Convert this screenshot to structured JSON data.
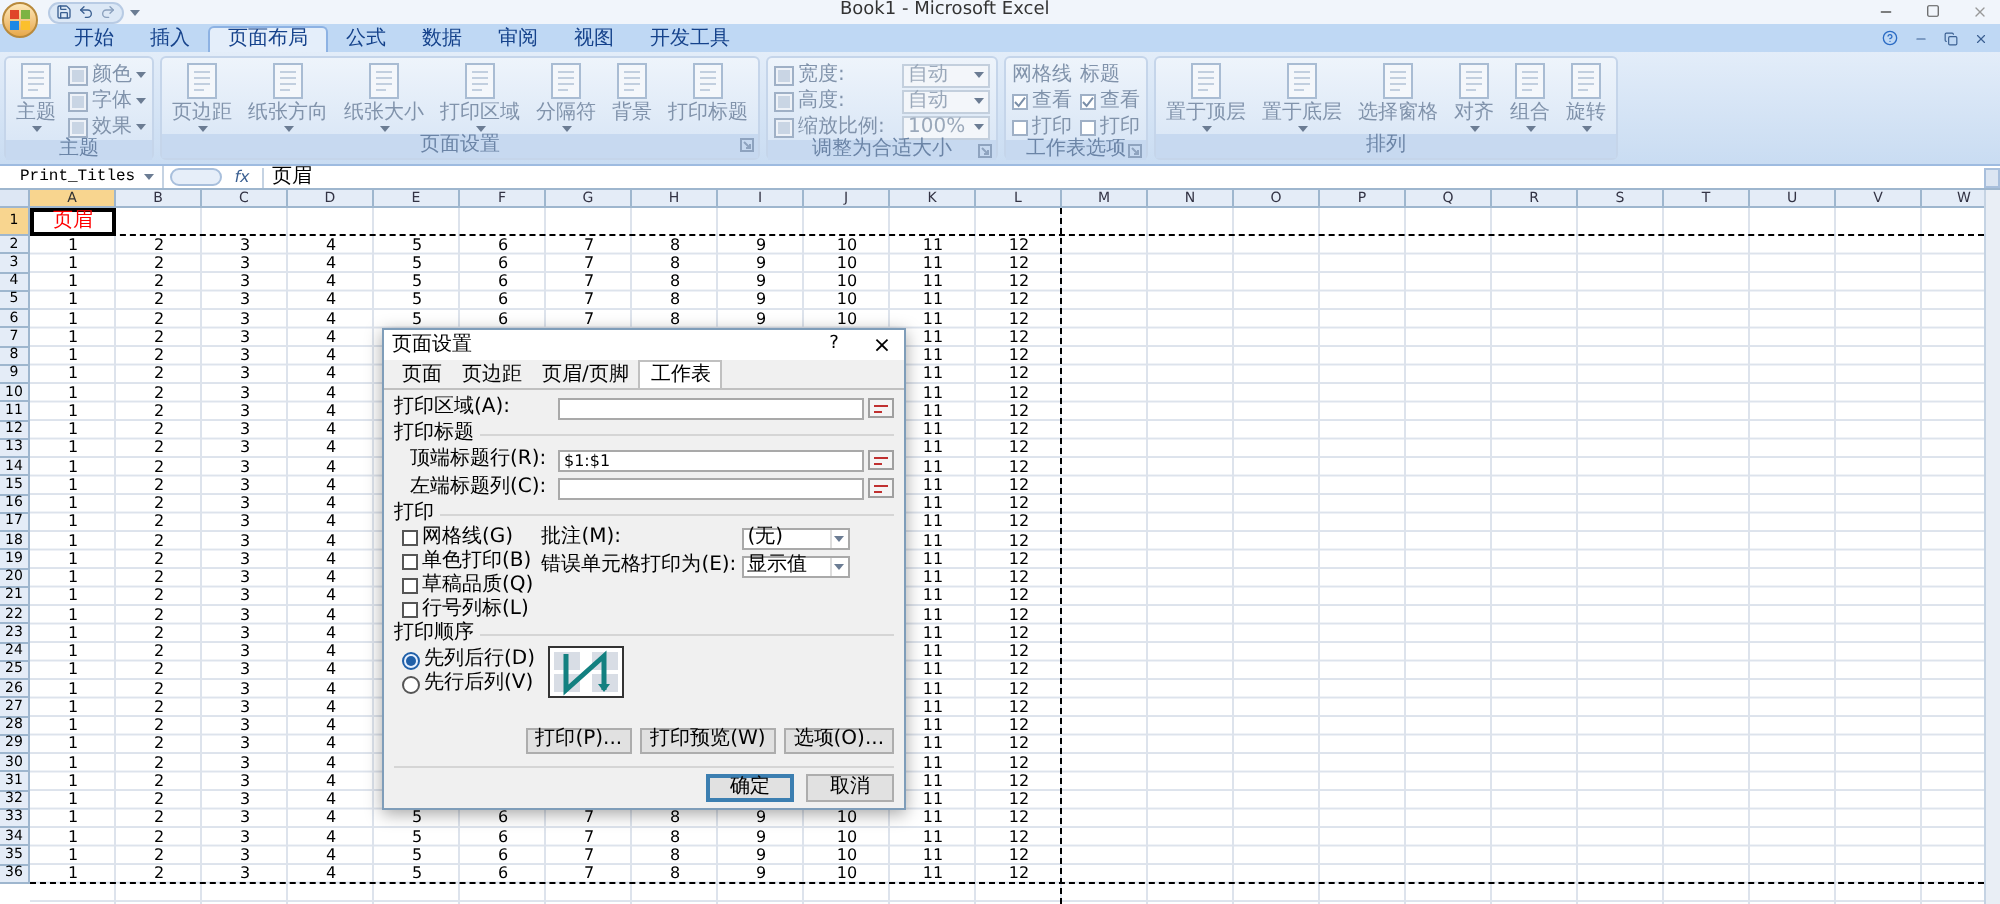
{
  "title_bar": {
    "title": "Book1 - Microsoft Excel"
  },
  "ribbon_tabs": [
    {
      "label": "开始",
      "selected": false
    },
    {
      "label": "插入",
      "selected": false
    },
    {
      "label": "页面布局",
      "selected": true
    },
    {
      "label": "公式",
      "selected": false
    },
    {
      "label": "数据",
      "selected": false
    },
    {
      "label": "审阅",
      "selected": false
    },
    {
      "label": "视图",
      "selected": false
    },
    {
      "label": "开发工具",
      "selected": false
    }
  ],
  "ribbon": {
    "disabled": true,
    "groups": [
      {
        "label": "主题",
        "launcher": false,
        "columns": [
          [
            {
              "kind": "big",
              "label": "主题",
              "caret": true
            }
          ],
          [
            {
              "kind": "small",
              "label": "颜色",
              "caret": true
            },
            {
              "kind": "small",
              "label": "字体",
              "caret": true
            },
            {
              "kind": "small",
              "label": "效果",
              "caret": true
            }
          ]
        ]
      },
      {
        "label": "页面设置",
        "launcher": true,
        "columns": [
          [
            {
              "kind": "big",
              "label": "页边距",
              "caret": true
            }
          ],
          [
            {
              "kind": "big",
              "label": "纸张方向",
              "caret": true
            }
          ],
          [
            {
              "kind": "big",
              "label": "纸张大小",
              "caret": true
            }
          ],
          [
            {
              "kind": "big",
              "label": "打印区域",
              "caret": true
            }
          ],
          [
            {
              "kind": "big",
              "label": "分隔符",
              "caret": true
            }
          ],
          [
            {
              "kind": "big",
              "label": "背景",
              "caret": false
            }
          ],
          [
            {
              "kind": "big",
              "label": "打印标题",
              "caret": false
            }
          ]
        ]
      },
      {
        "label": "调整为合适大小",
        "launcher": true,
        "columns": [
          [
            {
              "kind": "field",
              "label": "宽度:",
              "value": "自动"
            },
            {
              "kind": "field",
              "label": "高度:",
              "value": "自动"
            },
            {
              "kind": "spin",
              "label": "缩放比例:",
              "value": "100%"
            }
          ]
        ]
      },
      {
        "label": "工作表选项",
        "launcher": true,
        "columns": [
          [
            {
              "kind": "heading",
              "label": "网格线"
            },
            {
              "kind": "check",
              "label": "查看",
              "checked": true
            },
            {
              "kind": "check",
              "label": "打印",
              "checked": false
            }
          ],
          [
            {
              "kind": "heading",
              "label": "标题"
            },
            {
              "kind": "check",
              "label": "查看",
              "checked": true
            },
            {
              "kind": "check",
              "label": "打印",
              "checked": false
            }
          ]
        ]
      },
      {
        "label": "排列",
        "launcher": false,
        "columns": [
          [
            {
              "kind": "big",
              "label": "置于顶层",
              "caret": true
            }
          ],
          [
            {
              "kind": "big",
              "label": "置于底层",
              "caret": true
            }
          ],
          [
            {
              "kind": "big",
              "label": "选择窗格",
              "caret": false
            }
          ],
          [
            {
              "kind": "big",
              "label": "对齐",
              "caret": true
            }
          ],
          [
            {
              "kind": "big",
              "label": "组合",
              "caret": true
            }
          ],
          [
            {
              "kind": "big",
              "label": "旋转",
              "caret": true
            }
          ]
        ]
      }
    ]
  },
  "formula_bar": {
    "name_box": "Print_Titles",
    "function_button": "fx",
    "value": "页眉"
  },
  "sheet": {
    "columns": [
      {
        "label": "A",
        "selected": true,
        "page_break": false
      },
      {
        "label": "B",
        "selected": false,
        "page_break": false
      },
      {
        "label": "C",
        "selected": false,
        "page_break": false
      },
      {
        "label": "D",
        "selected": false,
        "page_break": false
      },
      {
        "label": "E",
        "selected": false,
        "page_break": false
      },
      {
        "label": "F",
        "selected": false,
        "page_break": false
      },
      {
        "label": "G",
        "selected": false,
        "page_break": false
      },
      {
        "label": "H",
        "selected": false,
        "page_break": false
      },
      {
        "label": "I",
        "selected": false,
        "page_break": false
      },
      {
        "label": "J",
        "selected": false,
        "page_break": false
      },
      {
        "label": "K",
        "selected": false,
        "page_break": false
      },
      {
        "label": "L",
        "selected": false,
        "page_break": true
      },
      {
        "label": "M",
        "selected": false,
        "page_break": false
      },
      {
        "label": "N",
        "selected": false,
        "page_break": false
      },
      {
        "label": "O",
        "selected": false,
        "page_break": false
      },
      {
        "label": "P",
        "selected": false,
        "page_break": false
      },
      {
        "label": "Q",
        "selected": false,
        "page_break": false
      },
      {
        "label": "R",
        "selected": false,
        "page_break": false
      },
      {
        "label": "S",
        "selected": false,
        "page_break": false
      },
      {
        "label": "T",
        "selected": false,
        "page_break": false
      },
      {
        "label": "U",
        "selected": false,
        "page_break": false
      },
      {
        "label": "V",
        "selected": false,
        "page_break": false
      },
      {
        "label": "W",
        "selected": false,
        "page_break": false
      }
    ],
    "rows": [
      {
        "header": "1",
        "selected": true,
        "page_break": true,
        "cells": [
          {
            "text": "页眉",
            "color": "#ff0000"
          }
        ]
      },
      {
        "header": "2",
        "selected": false,
        "page_break": false,
        "cells": [
          "1",
          "2",
          "3",
          "4",
          "5",
          "6",
          "7",
          "8",
          "9",
          "10",
          "11",
          "12"
        ]
      },
      {
        "header": "3",
        "selected": false,
        "page_break": false,
        "cells": [
          "1",
          "2",
          "3",
          "4",
          "5",
          "6",
          "7",
          "8",
          "9",
          "10",
          "11",
          "12"
        ]
      },
      {
        "header": "4",
        "selected": false,
        "page_break": false,
        "cells": [
          "1",
          "2",
          "3",
          "4",
          "5",
          "6",
          "7",
          "8",
          "9",
          "10",
          "11",
          "12"
        ]
      },
      {
        "header": "5",
        "selected": false,
        "page_break": false,
        "cells": [
          "1",
          "2",
          "3",
          "4",
          "5",
          "6",
          "7",
          "8",
          "9",
          "10",
          "11",
          "12"
        ]
      },
      {
        "header": "6",
        "selected": false,
        "page_break": false,
        "cells": [
          "1",
          "2",
          "3",
          "4",
          "5",
          "6",
          "7",
          "8",
          "9",
          "10",
          "11",
          "12"
        ]
      },
      {
        "header": "7",
        "selected": false,
        "page_break": false,
        "cells": [
          "1",
          "2",
          "3",
          "4",
          null,
          null,
          null,
          null,
          null,
          null,
          "11",
          "12"
        ]
      },
      {
        "header": "8",
        "selected": false,
        "page_break": false,
        "cells": [
          "1",
          "2",
          "3",
          "4",
          null,
          null,
          null,
          null,
          null,
          null,
          "11",
          "12"
        ]
      },
      {
        "header": "9",
        "selected": false,
        "page_break": false,
        "cells": [
          "1",
          "2",
          "3",
          "4",
          null,
          null,
          null,
          null,
          null,
          null,
          "11",
          "12"
        ]
      },
      {
        "header": "10",
        "selected": false,
        "page_break": false,
        "cells": [
          "1",
          "2",
          "3",
          "4",
          null,
          null,
          null,
          null,
          null,
          null,
          "11",
          "12"
        ]
      },
      {
        "header": "11",
        "selected": false,
        "page_break": false,
        "cells": [
          "1",
          "2",
          "3",
          "4",
          null,
          null,
          null,
          null,
          null,
          null,
          "11",
          "12"
        ]
      },
      {
        "header": "12",
        "selected": false,
        "page_break": false,
        "cells": [
          "1",
          "2",
          "3",
          "4",
          null,
          null,
          null,
          null,
          null,
          null,
          "11",
          "12"
        ]
      },
      {
        "header": "13",
        "selected": false,
        "page_break": false,
        "cells": [
          "1",
          "2",
          "3",
          "4",
          null,
          null,
          null,
          null,
          null,
          null,
          "11",
          "12"
        ]
      },
      {
        "header": "14",
        "selected": false,
        "page_break": false,
        "cells": [
          "1",
          "2",
          "3",
          "4",
          null,
          null,
          null,
          null,
          null,
          null,
          "11",
          "12"
        ]
      },
      {
        "header": "15",
        "selected": false,
        "page_break": false,
        "cells": [
          "1",
          "2",
          "3",
          "4",
          null,
          null,
          null,
          null,
          null,
          null,
          "11",
          "12"
        ]
      },
      {
        "header": "16",
        "selected": false,
        "page_break": false,
        "cells": [
          "1",
          "2",
          "3",
          "4",
          null,
          null,
          null,
          null,
          null,
          null,
          "11",
          "12"
        ]
      },
      {
        "header": "17",
        "selected": false,
        "page_break": false,
        "cells": [
          "1",
          "2",
          "3",
          "4",
          null,
          null,
          null,
          null,
          null,
          null,
          "11",
          "12"
        ]
      },
      {
        "header": "18",
        "selected": false,
        "page_break": false,
        "cells": [
          "1",
          "2",
          "3",
          "4",
          null,
          null,
          null,
          null,
          null,
          null,
          "11",
          "12"
        ]
      },
      {
        "header": "19",
        "selected": false,
        "page_break": false,
        "cells": [
          "1",
          "2",
          "3",
          "4",
          null,
          null,
          null,
          null,
          null,
          null,
          "11",
          "12"
        ]
      },
      {
        "header": "20",
        "selected": false,
        "page_break": false,
        "cells": [
          "1",
          "2",
          "3",
          "4",
          null,
          null,
          null,
          null,
          null,
          null,
          "11",
          "12"
        ]
      },
      {
        "header": "21",
        "selected": false,
        "page_break": false,
        "cells": [
          "1",
          "2",
          "3",
          "4",
          null,
          null,
          null,
          null,
          null,
          null,
          "11",
          "12"
        ]
      },
      {
        "header": "22",
        "selected": false,
        "page_break": false,
        "cells": [
          "1",
          "2",
          "3",
          "4",
          null,
          null,
          null,
          null,
          null,
          null,
          "11",
          "12"
        ]
      },
      {
        "header": "23",
        "selected": false,
        "page_break": false,
        "cells": [
          "1",
          "2",
          "3",
          "4",
          null,
          null,
          null,
          null,
          null,
          null,
          "11",
          "12"
        ]
      },
      {
        "header": "24",
        "selected": false,
        "page_break": false,
        "cells": [
          "1",
          "2",
          "3",
          "4",
          null,
          null,
          null,
          null,
          null,
          null,
          "11",
          "12"
        ]
      },
      {
        "header": "25",
        "selected": false,
        "page_break": false,
        "cells": [
          "1",
          "2",
          "3",
          "4",
          null,
          null,
          null,
          null,
          null,
          null,
          "11",
          "12"
        ]
      },
      {
        "header": "26",
        "selected": false,
        "page_break": false,
        "cells": [
          "1",
          "2",
          "3",
          "4",
          null,
          null,
          null,
          null,
          null,
          null,
          "11",
          "12"
        ]
      },
      {
        "header": "27",
        "selected": false,
        "page_break": false,
        "cells": [
          "1",
          "2",
          "3",
          "4",
          null,
          null,
          null,
          null,
          null,
          null,
          "11",
          "12"
        ]
      },
      {
        "header": "28",
        "selected": false,
        "page_break": false,
        "cells": [
          "1",
          "2",
          "3",
          "4",
          null,
          null,
          null,
          null,
          null,
          null,
          "11",
          "12"
        ]
      },
      {
        "header": "29",
        "selected": false,
        "page_break": false,
        "cells": [
          "1",
          "2",
          "3",
          "4",
          null,
          null,
          null,
          null,
          null,
          null,
          "11",
          "12"
        ]
      },
      {
        "header": "30",
        "selected": false,
        "page_break": false,
        "cells": [
          "1",
          "2",
          "3",
          "4",
          null,
          null,
          null,
          null,
          null,
          null,
          "11",
          "12"
        ]
      },
      {
        "header": "31",
        "selected": false,
        "page_break": false,
        "cells": [
          "1",
          "2",
          "3",
          "4",
          null,
          null,
          null,
          null,
          null,
          null,
          "11",
          "12"
        ]
      },
      {
        "header": "32",
        "selected": false,
        "page_break": false,
        "cells": [
          "1",
          "2",
          "3",
          "4",
          null,
          null,
          null,
          null,
          null,
          null,
          "11",
          "12"
        ]
      },
      {
        "header": "33",
        "selected": false,
        "page_break": false,
        "cells": [
          "1",
          "2",
          "3",
          "4",
          "5",
          "6",
          "7",
          "8",
          "9",
          "10",
          "11",
          "12"
        ]
      },
      {
        "header": "34",
        "selected": false,
        "page_break": false,
        "cells": [
          "1",
          "2",
          "3",
          "4",
          "5",
          "6",
          "7",
          "8",
          "9",
          "10",
          "11",
          "12"
        ]
      },
      {
        "header": "35",
        "selected": false,
        "page_break": false,
        "cells": [
          "1",
          "2",
          "3",
          "4",
          "5",
          "6",
          "7",
          "8",
          "9",
          "10",
          "11",
          "12"
        ]
      },
      {
        "header": "36",
        "selected": false,
        "page_break": true,
        "cells": [
          "1",
          "2",
          "3",
          "4",
          "5",
          "6",
          "7",
          "8",
          "9",
          "10",
          "11",
          "12"
        ]
      }
    ]
  },
  "dialog": {
    "title": "页面设置",
    "help": "?",
    "close": "×",
    "tabs": [
      {
        "label": "页面",
        "selected": false
      },
      {
        "label": "页边距",
        "selected": false
      },
      {
        "label": "页眉/页脚",
        "selected": false
      },
      {
        "label": "工作表",
        "selected": true
      }
    ],
    "print_area": {
      "label": "打印区域(A):"
    },
    "print_titles": {
      "label": "打印标题",
      "rows": {
        "label": "顶端标题行(R):",
        "value": "$1:$1"
      },
      "columns": {
        "label": "左端标题列(C):"
      }
    },
    "print": {
      "label": "打印",
      "options": [
        {
          "label": "网格线(G)",
          "checked": false
        },
        {
          "label": "单色打印(B)",
          "checked": false
        },
        {
          "label": "草稿品质(Q)",
          "checked": false
        },
        {
          "label": "行号列标(L)",
          "checked": false
        }
      ],
      "comments": {
        "label": "批注(M):",
        "value": "(无)"
      },
      "errors": {
        "label": "错误单元格打印为(E):",
        "value": "显示值"
      }
    },
    "page_order": {
      "label": "打印顺序",
      "options": [
        {
          "label": "先列后行(D)",
          "selected": true
        },
        {
          "label": "先行后列(V)",
          "selected": false
        }
      ]
    },
    "buttons": [
      "打印(P)...",
      "打印预览(W)",
      "选项(O)..."
    ],
    "footer_buttons": [
      {
        "label": "确定",
        "default": true
      },
      {
        "label": "取消",
        "default": false
      }
    ]
  }
}
